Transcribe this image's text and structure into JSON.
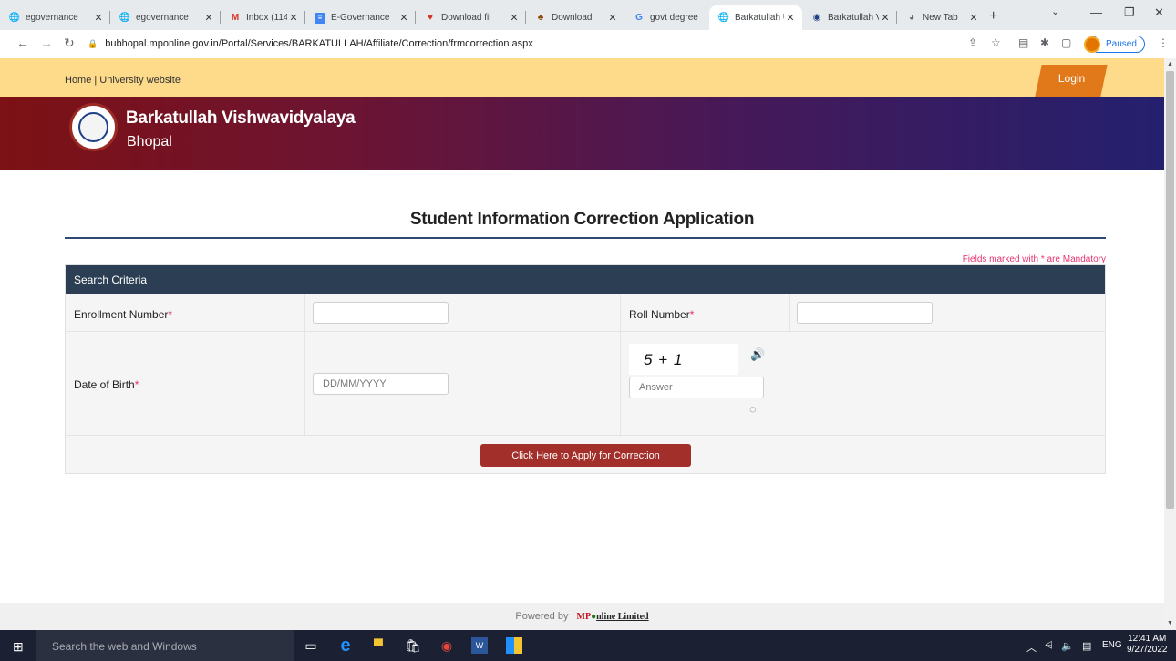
{
  "browser": {
    "tabs": [
      {
        "title": "egovernance",
        "favicon": "globe-icon"
      },
      {
        "title": "egovernance",
        "favicon": "globe-icon"
      },
      {
        "title": "Inbox (114)",
        "favicon": "gmail-icon"
      },
      {
        "title": "E-Governance",
        "favicon": "forms-icon"
      },
      {
        "title": "Download fil",
        "favicon": "heart-icon"
      },
      {
        "title": "Download",
        "favicon": "download-site-icon"
      },
      {
        "title": "govt degree",
        "favicon": "google-icon"
      },
      {
        "title": "Barkatullah U",
        "favicon": "globe-icon"
      },
      {
        "title": "Barkatullah V",
        "favicon": "university-icon"
      },
      {
        "title": "New Tab",
        "favicon": "chrome-icon"
      }
    ],
    "url": "bubhopal.mponline.gov.in/Portal/Services/BARKATULLAH/Affiliate/Correction/frmcorrection.aspx",
    "profile_status": "Paused"
  },
  "page": {
    "topbar_links": "Home | University website",
    "login_label": "Login",
    "university_name": "Barkatullah Vishwavidyalaya",
    "university_city": "Bhopal",
    "form_title": "Student Information Correction Application",
    "mandatory_note": "Fields marked with * are Mandatory",
    "panel_title": "Search Criteria",
    "fields": {
      "enrollment_label": "Enrollment Number",
      "roll_label": "Roll Number",
      "dob_label": "Date of Birth",
      "dob_placeholder": "DD/MM/YYYY",
      "captcha_text": "5 + 1",
      "answer_placeholder": "Answer",
      "required_mark": "*"
    },
    "submit_label": "Click Here to Apply for Correction",
    "footer_powered": "Powered by",
    "footer_brand_a": "MP",
    "footer_brand_b": "nline Limited"
  },
  "taskbar": {
    "search_placeholder": "Search the web and Windows",
    "language": "ENG",
    "time": "12:41 AM",
    "date": "9/27/2022"
  }
}
